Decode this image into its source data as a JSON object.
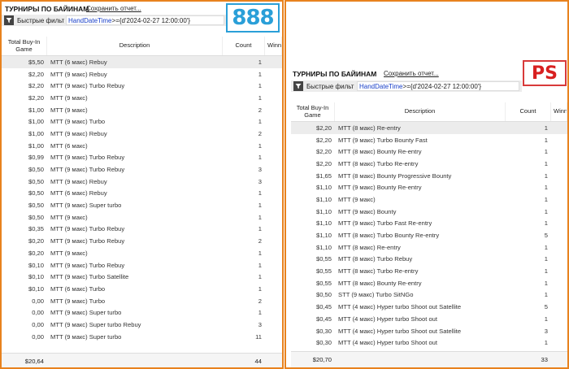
{
  "left": {
    "title": "ТУРНИРЫ ПО БАЙИНАМ",
    "save_link": "Сохранить отчет...",
    "filter_label": "Быстрые фильт",
    "filter_key": "HandDateTime",
    "filter_value": ">={d'2024-02-27 12:00:00'}",
    "badge": "888",
    "columns": {
      "buy": "Total Buy-In Game",
      "desc": "Description",
      "count": "Count",
      "win": "Winnings"
    },
    "rows": [
      {
        "buy": "$5,50",
        "desc": "MTT (6 макс) Rebuy",
        "count": "1"
      },
      {
        "buy": "$2,20",
        "desc": "MTT (9 макс) Rebuy",
        "count": "1"
      },
      {
        "buy": "$2,20",
        "desc": "MTT (9 макс) Turbo Rebuy",
        "count": "1"
      },
      {
        "buy": "$2,20",
        "desc": "MTT (9 макс)",
        "count": "1"
      },
      {
        "buy": "$1,00",
        "desc": "MTT (9 макс)",
        "count": "2"
      },
      {
        "buy": "$1,00",
        "desc": "MTT (9 макс) Turbo",
        "count": "1"
      },
      {
        "buy": "$1,00",
        "desc": "MTT (9 макс) Rebuy",
        "count": "2"
      },
      {
        "buy": "$1,00",
        "desc": "MTT (6 макс)",
        "count": "1"
      },
      {
        "buy": "$0,99",
        "desc": "MTT (9 макс) Turbo Rebuy",
        "count": "1"
      },
      {
        "buy": "$0,50",
        "desc": "MTT (9 макс) Turbo Rebuy",
        "count": "3"
      },
      {
        "buy": "$0,50",
        "desc": "MTT (9 макс) Rebuy",
        "count": "3"
      },
      {
        "buy": "$0,50",
        "desc": "MTT (6 макс) Rebuy",
        "count": "1"
      },
      {
        "buy": "$0,50",
        "desc": "MTT (9 макс) Super turbo",
        "count": "1"
      },
      {
        "buy": "$0,50",
        "desc": "MTT (9 макс)",
        "count": "1"
      },
      {
        "buy": "$0,35",
        "desc": "MTT (9 макс) Turbo Rebuy",
        "count": "1"
      },
      {
        "buy": "$0,20",
        "desc": "MTT (9 макс) Turbo Rebuy",
        "count": "2"
      },
      {
        "buy": "$0,20",
        "desc": "MTT (9 макс)",
        "count": "1"
      },
      {
        "buy": "$0,10",
        "desc": "MTT (9 макс) Turbo Rebuy",
        "count": "1"
      },
      {
        "buy": "$0,10",
        "desc": "MTT (9 макс) Turbo Satellite",
        "count": "1"
      },
      {
        "buy": "$0,10",
        "desc": "MTT (6 макс) Turbo",
        "count": "1"
      },
      {
        "buy": "0,00",
        "desc": "MTT (9 макс) Turbo",
        "count": "2"
      },
      {
        "buy": "0,00",
        "desc": "MTT (9 макс) Super turbo",
        "count": "1"
      },
      {
        "buy": "0,00",
        "desc": "MTT (9 макс) Super turbo Rebuy",
        "count": "3"
      },
      {
        "buy": "0,00",
        "desc": "MTT (9 макс) Super turbo",
        "count": "11"
      }
    ],
    "total_buy": "$20,64",
    "total_count": "44"
  },
  "right": {
    "title": "ТУРНИРЫ ПО БАЙИНАМ",
    "save_link": "Сохранить отчет...",
    "filter_label": "Быстрые фильт",
    "filter_key": "HandDateTime",
    "filter_value": ">={d'2024-02-27 12:00:00'}",
    "badge": "PS",
    "columns": {
      "buy": "Total Buy-In Game",
      "desc": "Description",
      "count": "Count",
      "win": "Winnings"
    },
    "rows": [
      {
        "buy": "$2,20",
        "desc": "MTT (8 макс) Re-entry",
        "count": "1"
      },
      {
        "buy": "$2,20",
        "desc": "MTT (9 макс) Turbo Bounty Fast",
        "count": "1"
      },
      {
        "buy": "$2,20",
        "desc": "MTT (8 макс) Bounty Re-entry",
        "count": "1"
      },
      {
        "buy": "$2,20",
        "desc": "MTT (8 макс) Turbo Re-entry",
        "count": "1"
      },
      {
        "buy": "$1,65",
        "desc": "MTT (8 макс) Bounty Progressive Bounty",
        "count": "1"
      },
      {
        "buy": "$1,10",
        "desc": "MTT (9 макс) Bounty Re-entry",
        "count": "1"
      },
      {
        "buy": "$1,10",
        "desc": "MTT (9 макс)",
        "count": "1"
      },
      {
        "buy": "$1,10",
        "desc": "MTT (9 макс) Bounty",
        "count": "1"
      },
      {
        "buy": "$1,10",
        "desc": "MTT (9 макс) Turbo Fast Re-entry",
        "count": "1"
      },
      {
        "buy": "$1,10",
        "desc": "MTT (8 макс) Turbo Bounty Re-entry",
        "count": "5"
      },
      {
        "buy": "$1,10",
        "desc": "MTT (8 макс) Re-entry",
        "count": "1"
      },
      {
        "buy": "$0,55",
        "desc": "MTT (8 макс) Turbo Rebuy",
        "count": "1"
      },
      {
        "buy": "$0,55",
        "desc": "MTT (8 макс) Turbo Re-entry",
        "count": "1"
      },
      {
        "buy": "$0,55",
        "desc": "MTT (8 макс) Bounty Re-entry",
        "count": "1"
      },
      {
        "buy": "$0,50",
        "desc": "STT (9 макс) Turbo SitNGo",
        "count": "1"
      },
      {
        "buy": "$0,45",
        "desc": "MTT (4 макс) Hyper turbo Shoot out Satellite",
        "count": "5"
      },
      {
        "buy": "$0,45",
        "desc": "MTT (4 макс) Hyper turbo Shoot out",
        "count": "1"
      },
      {
        "buy": "$0,30",
        "desc": "MTT (4 макс) Hyper turbo Shoot out Satellite",
        "count": "3"
      },
      {
        "buy": "$0,30",
        "desc": "MTT (4 макс) Hyper turbo Shoot out",
        "count": "1"
      }
    ],
    "total_buy": "$20,70",
    "total_count": "33"
  },
  "colors": {
    "panel_border": "#e8821e",
    "badge_888": "#2a9fd8",
    "badge_ps": "#d82020",
    "filter_key": "#1a40c8"
  },
  "icons": {
    "filter_button": "filter-icon"
  }
}
